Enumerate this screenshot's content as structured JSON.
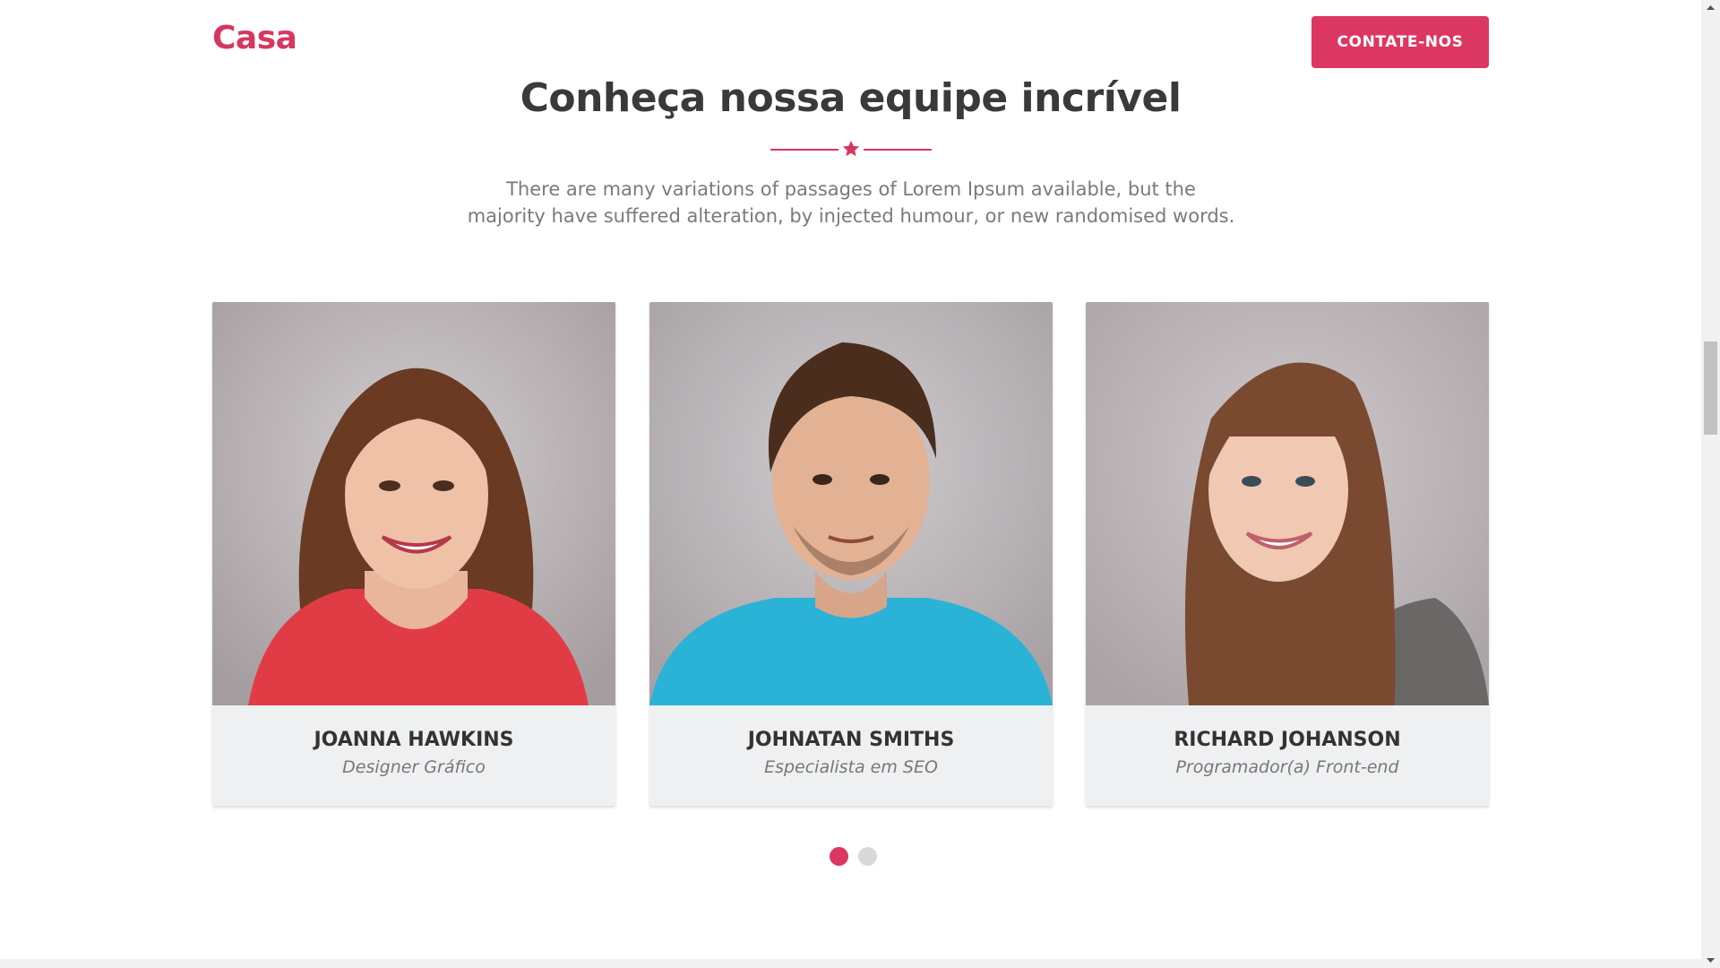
{
  "header": {
    "brand": "Casa",
    "cta_label": "CONTATE-NOS"
  },
  "team": {
    "title": "Conheça nossa equipe incrível",
    "intro": "There are many variations of passages of Lorem Ipsum available, but the majority have suffered alteration, by injected humour, or new randomised words.",
    "members": [
      {
        "name": "JOANNA HAWKINS",
        "role": "Designer Gráfico"
      },
      {
        "name": "JOHNATAN SMITHS",
        "role": "Especialista em SEO"
      },
      {
        "name": "RICHARD JOHANSON",
        "role": "Programador(a) Front-end"
      }
    ],
    "carousel": {
      "pages": 2,
      "active": 1
    }
  },
  "colors": {
    "accent": "#dc3762",
    "heading": "#3a3a3a",
    "card_bg": "#eff0f2"
  }
}
